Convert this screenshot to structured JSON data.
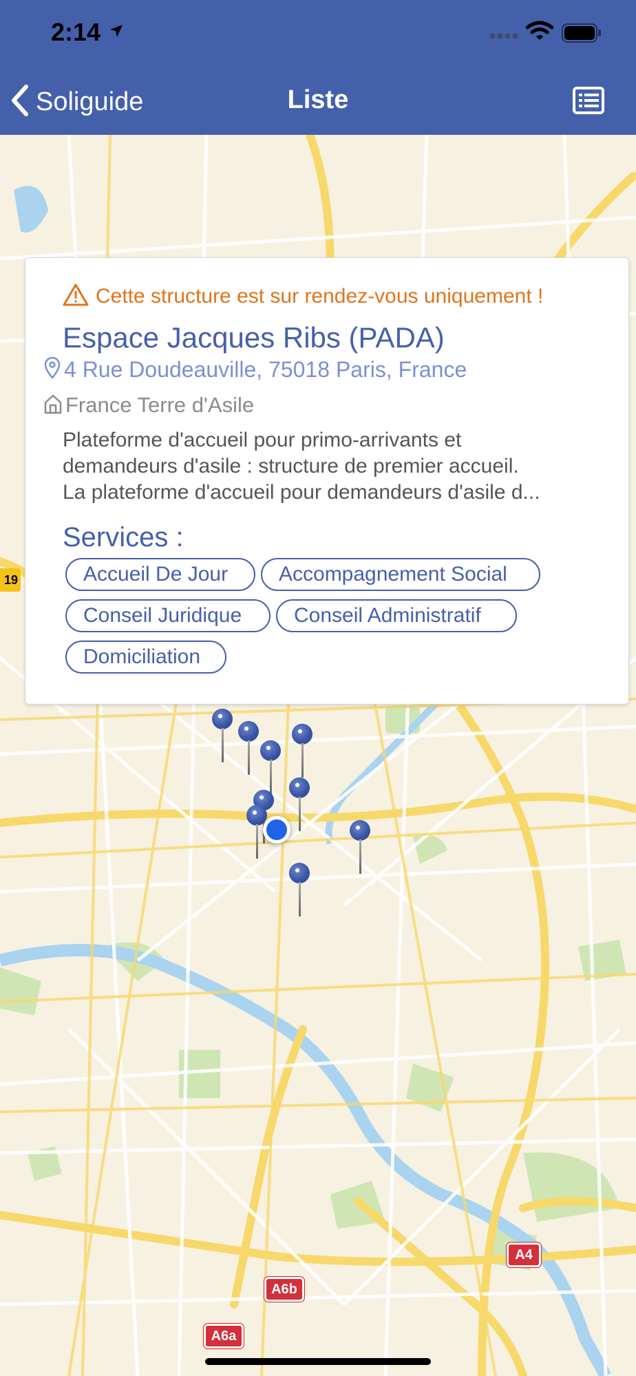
{
  "status_bar": {
    "time": "2:14"
  },
  "nav": {
    "back_label": "Soliguide",
    "title": "Liste"
  },
  "card": {
    "warning": "Cette structure est sur rendez-vous uniquement !",
    "title": "Espace Jacques Ribs (PADA)",
    "address": "4 Rue Doudeauville, 75018 Paris, France",
    "organization": "France Terre d'Asile",
    "description_lines": [
      "Plateforme d'accueil pour primo-arrivants et",
      "demandeurs d'asile : structure de premier accueil.",
      "La plateforme d'accueil pour demandeurs d'asile d..."
    ],
    "services_title": "Services :",
    "services": [
      "Accueil De Jour",
      "Accompagnement Social",
      "Conseil Juridique",
      "Conseil Administratif",
      "Domiciliation"
    ]
  },
  "map": {
    "road_labels": [
      "19",
      "A4",
      "A6b",
      "A6a"
    ],
    "pin_count": 9
  },
  "colors": {
    "brand": "#4560ab",
    "warning": "#e0741c",
    "address": "#7b90d2",
    "user_location": "#1e63e8"
  }
}
